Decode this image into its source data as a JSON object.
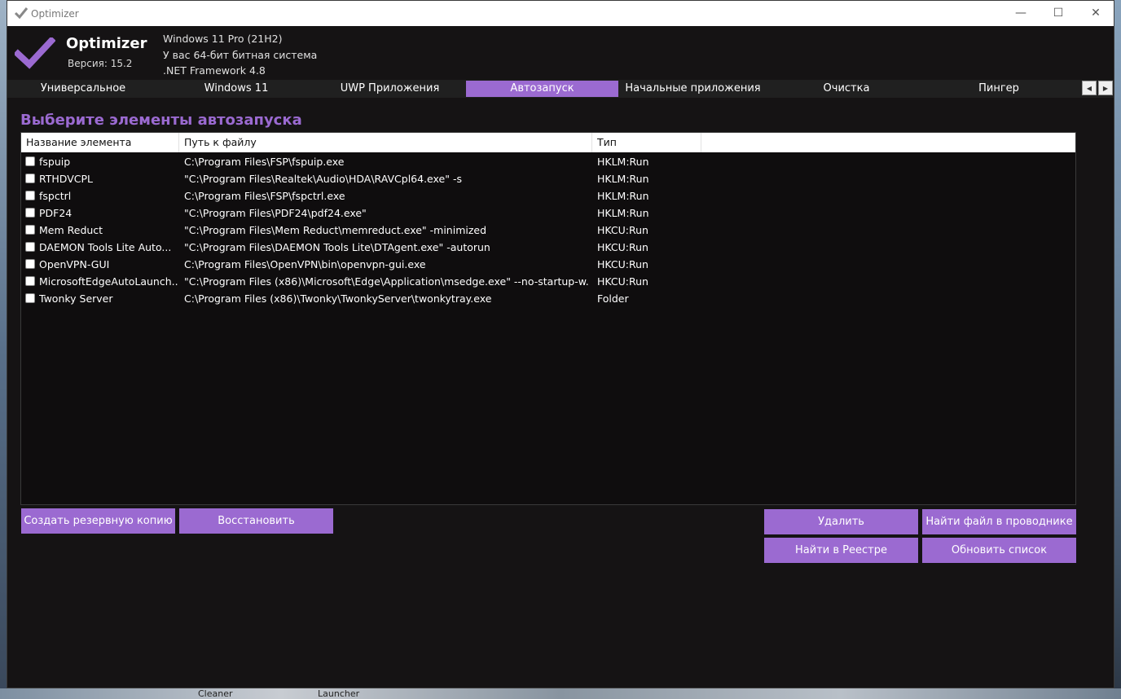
{
  "window": {
    "title": "Optimizer"
  },
  "window_controls": {
    "minimize": "—",
    "maximize": "☐",
    "close": "✕"
  },
  "header": {
    "app_name": "Optimizer",
    "version": "Версия: 15.2",
    "sys_info": [
      "Windows 11 Pro (21H2)",
      "У вас 64-бит битная система",
      ".NET Framework 4.8"
    ]
  },
  "tabs": [
    {
      "label": "Универсальное",
      "active": false
    },
    {
      "label": "Windows 11",
      "active": false
    },
    {
      "label": "UWP Приложения",
      "active": false
    },
    {
      "label": "Автозапуск",
      "active": true
    },
    {
      "label": "Начальные приложения",
      "active": false
    },
    {
      "label": "Очистка",
      "active": false
    },
    {
      "label": "Пингер",
      "active": false
    }
  ],
  "tab_scroll": {
    "left": "◀",
    "right": "▶"
  },
  "page": {
    "title": "Выберите элементы автозапуска"
  },
  "list": {
    "columns": [
      "Название элемента",
      "Путь к файлу",
      "Тип"
    ],
    "rows": [
      {
        "name": "fspuip",
        "path": "C:\\Program Files\\FSP\\fspuip.exe",
        "type": "HKLM:Run",
        "checked": false
      },
      {
        "name": "RTHDVCPL",
        "path": "\"C:\\Program Files\\Realtek\\Audio\\HDA\\RAVCpl64.exe\" -s",
        "type": "HKLM:Run",
        "checked": false
      },
      {
        "name": "fspctrl",
        "path": "C:\\Program Files\\FSP\\fspctrl.exe",
        "type": "HKLM:Run",
        "checked": false
      },
      {
        "name": "PDF24",
        "path": "\"C:\\Program Files\\PDF24\\pdf24.exe\"",
        "type": "HKLM:Run",
        "checked": false
      },
      {
        "name": "Mem Reduct",
        "path": "\"C:\\Program Files\\Mem Reduct\\memreduct.exe\" -minimized",
        "type": "HKCU:Run",
        "checked": false
      },
      {
        "name": "DAEMON Tools Lite Auto...",
        "path": "\"C:\\Program Files\\DAEMON Tools Lite\\DTAgent.exe\" -autorun",
        "type": "HKCU:Run",
        "checked": false
      },
      {
        "name": "OpenVPN-GUI",
        "path": "C:\\Program Files\\OpenVPN\\bin\\openvpn-gui.exe",
        "type": "HKCU:Run",
        "checked": false
      },
      {
        "name": "MicrosoftEdgeAutoLaunch...",
        "path": "\"C:\\Program Files (x86)\\Microsoft\\Edge\\Application\\msedge.exe\" --no-startup-w...",
        "type": "HKCU:Run",
        "checked": false
      },
      {
        "name": "Twonky Server",
        "path": "C:\\Program Files (x86)\\Twonky\\TwonkyServer\\twonkytray.exe",
        "type": "Folder",
        "checked": false
      }
    ]
  },
  "buttons": {
    "backup": "Создать резервную копию",
    "restore": "Восстановить",
    "delete": "Удалить",
    "find_explorer": "Найти файл в проводнике",
    "find_registry": "Найти в Реестре",
    "refresh": "Обновить список"
  },
  "taskbar": {
    "left_label": "Cleaner",
    "right_label": "Launcher"
  },
  "colors": {
    "accent": "#9b6ad1",
    "background": "#151314",
    "list_bg": "#0f0d0e"
  }
}
